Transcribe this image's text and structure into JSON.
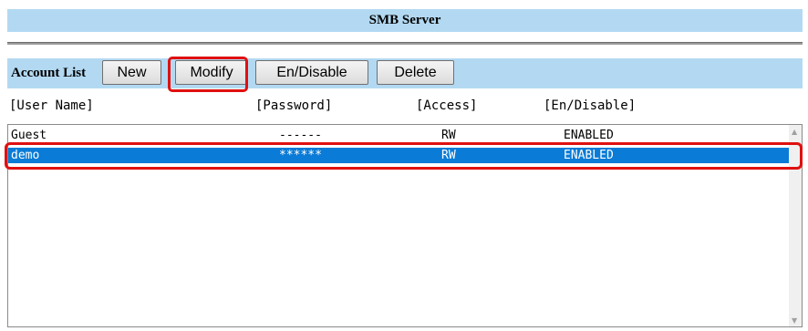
{
  "title": "SMB Server",
  "toolbar": {
    "label": "Account List",
    "buttons": {
      "new": "New",
      "modify": "Modify",
      "endisable": "En/Disable",
      "delete": "Delete"
    }
  },
  "columns": {
    "user": "[User Name]",
    "password": "[Password]",
    "access": "[Access]",
    "endisable": "[En/Disable]"
  },
  "accounts": [
    {
      "user": "Guest",
      "password": "------",
      "access": "RW",
      "status": "ENABLED"
    },
    {
      "user": "demo",
      "password": "******",
      "access": "RW",
      "status": "ENABLED"
    }
  ],
  "selected_index": 1,
  "colors": {
    "header_bg": "#b3d9f2",
    "selection": "#0a7bd6",
    "highlight": "#e01010"
  },
  "icons": {
    "scroll_up": "▲",
    "scroll_down": "▼"
  }
}
